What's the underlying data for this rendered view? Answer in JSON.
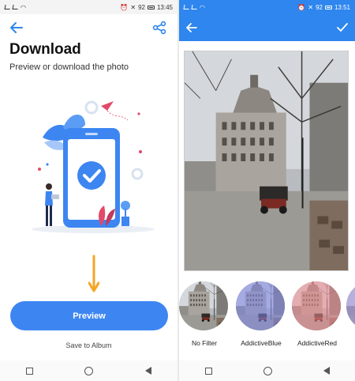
{
  "left": {
    "status": {
      "time": "13:45",
      "battery": "92"
    },
    "title": "Download",
    "subtitle": "Preview or download the photo",
    "preview_label": "Preview",
    "save_label": "Save to Album"
  },
  "right": {
    "status": {
      "time": "13:51",
      "battery": "92"
    },
    "filters": [
      {
        "label": "No Filter",
        "tint": ""
      },
      {
        "label": "AddictiveBlue",
        "tint": "#7d86e8"
      },
      {
        "label": "AddictiveRed",
        "tint": "#f08a90"
      },
      {
        "label": "",
        "tint": "#9a8fe0"
      }
    ]
  },
  "colors": {
    "accent": "#2e86ee",
    "button": "#3d86f2",
    "arrow": "#f5a623"
  },
  "icons": [
    "back-arrow-icon",
    "share-icon",
    "check-icon",
    "nav-square-icon",
    "nav-home-icon",
    "nav-back-icon"
  ]
}
